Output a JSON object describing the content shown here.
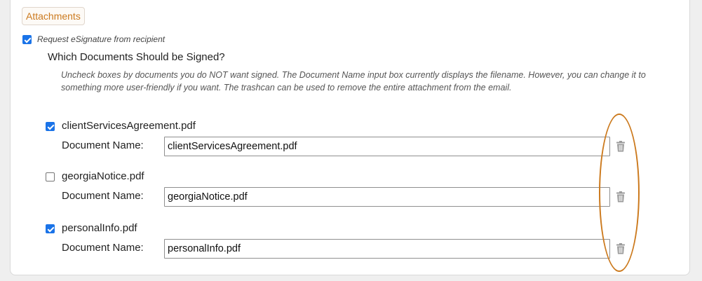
{
  "tab": {
    "label": "Attachments"
  },
  "esignature": {
    "checked": true,
    "label": "Request eSignature from recipient"
  },
  "heading": "Which Documents Should be Signed?",
  "instructions": "Uncheck boxes by documents you do NOT want signed. The Document Name input box currently displays the filename. However, you can change it to something more user-friendly if you want. The trashcan can be used to remove the entire attachment from the email.",
  "document_name_label": "Document Name:",
  "documents": [
    {
      "filename": "clientServicesAgreement.pdf",
      "checked": true,
      "document_name": "clientServicesAgreement.pdf"
    },
    {
      "filename": "georgiaNotice.pdf",
      "checked": false,
      "document_name": "georgiaNotice.pdf"
    },
    {
      "filename": "personalInfo.pdf",
      "checked": true,
      "document_name": "personalInfo.pdf"
    }
  ],
  "icons": {
    "trash": "trash-icon"
  },
  "colors": {
    "accent": "#cc7a1e",
    "checkbox": "#1a73e8"
  }
}
